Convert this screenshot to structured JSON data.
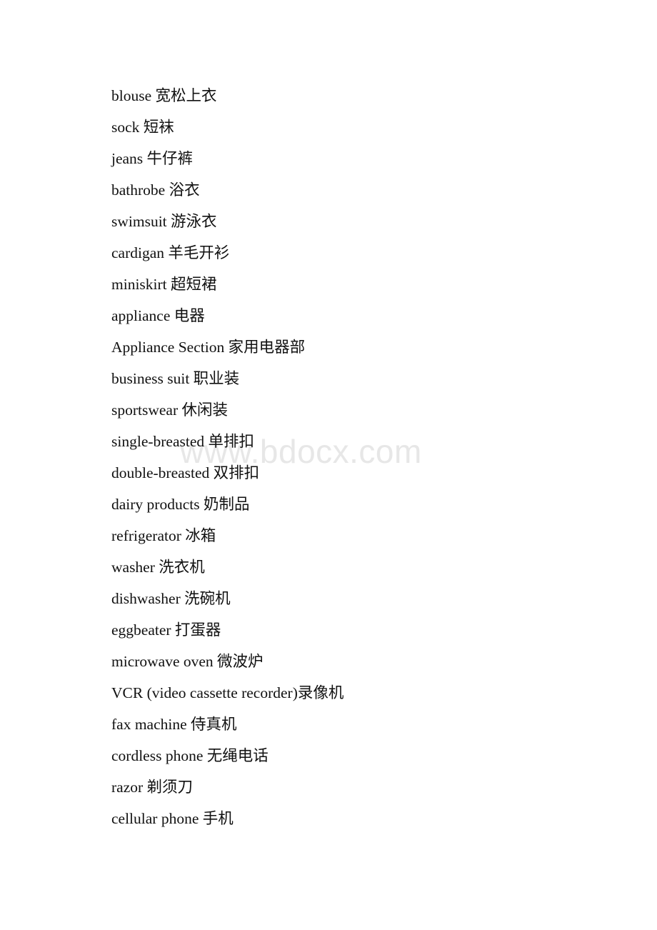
{
  "document": {
    "background_color": "#ffffff",
    "text_color": "#111111",
    "watermark": {
      "text": "www.bdocx.com",
      "color": "#e7e7e7"
    },
    "lines": [
      {
        "english": "blouse",
        "chinese": "宽松上衣",
        "text": "blouse 宽松上衣"
      },
      {
        "english": "sock",
        "chinese": "短袜",
        "text": "sock 短袜"
      },
      {
        "english": "jeans",
        "chinese": "牛仔裤",
        "text": "jeans 牛仔裤"
      },
      {
        "english": "bathrobe",
        "chinese": "浴衣",
        "text": "bathrobe 浴衣"
      },
      {
        "english": "swimsuit",
        "chinese": "游泳衣",
        "text": "swimsuit 游泳衣"
      },
      {
        "english": "cardigan",
        "chinese": "羊毛开衫",
        "text": "cardigan 羊毛开衫"
      },
      {
        "english": "miniskirt",
        "chinese": "超短裙",
        "text": "miniskirt 超短裙"
      },
      {
        "english": "appliance",
        "chinese": "电器",
        "text": "appliance 电器"
      },
      {
        "english": "Appliance Section",
        "chinese": "家用电器部",
        "text": "Appliance Section 家用电器部"
      },
      {
        "english": "business suit",
        "chinese": "职业装",
        "text": "business suit 职业装"
      },
      {
        "english": "sportswear",
        "chinese": "休闲装",
        "text": "sportswear 休闲装"
      },
      {
        "english": "single-breasted",
        "chinese": "单排扣",
        "text": "single-breasted 单排扣"
      },
      {
        "english": "double-breasted",
        "chinese": "双排扣",
        "text": "double-breasted 双排扣"
      },
      {
        "english": "dairy products",
        "chinese": "奶制品",
        "text": "dairy products 奶制品"
      },
      {
        "english": "refrigerator",
        "chinese": "冰箱",
        "text": "refrigerator 冰箱"
      },
      {
        "english": "washer",
        "chinese": "洗衣机",
        "text": "washer 洗衣机"
      },
      {
        "english": "dishwasher",
        "chinese": "洗碗机",
        "text": "dishwasher 洗碗机"
      },
      {
        "english": "eggbeater",
        "chinese": "打蛋器",
        "text": "eggbeater 打蛋器"
      },
      {
        "english": "microwave oven",
        "chinese": "微波炉",
        "text": "microwave oven 微波炉"
      },
      {
        "english": "VCR (video cassette recorder)",
        "chinese": "录像机",
        "text": "VCR (video cassette recorder)录像机"
      },
      {
        "english": "fax machine",
        "chinese": "侍真机",
        "text": "fax machine 侍真机"
      },
      {
        "english": "cordless phone",
        "chinese": "无绳电话",
        "text": "cordless phone 无绳电话"
      },
      {
        "english": "razor",
        "chinese": "剃须刀",
        "text": "razor 剃须刀"
      },
      {
        "english": "cellular phone",
        "chinese": "手机",
        "text": "cellular phone 手机"
      }
    ]
  }
}
